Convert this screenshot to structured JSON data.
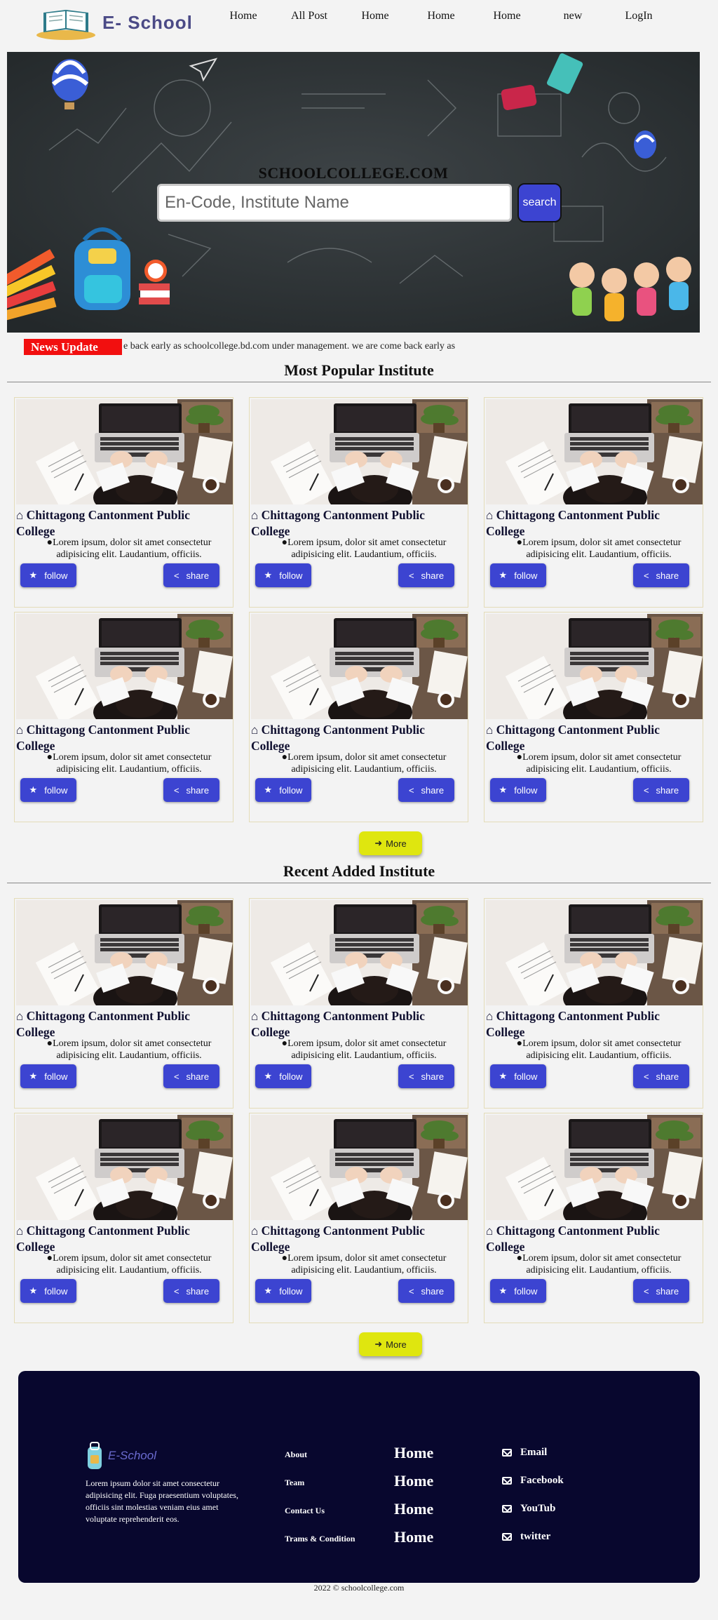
{
  "header": {
    "logo_text": "E- School",
    "nav": [
      "Home",
      "All Post",
      "Home",
      "Home",
      "Home",
      "new",
      "LogIn"
    ]
  },
  "hero": {
    "title": "SCHOOLCOLLEGE.COM",
    "search_placeholder": "En-Code, Institute Name",
    "search_button": "search"
  },
  "ticker": {
    "label": "News Update",
    "text": "e back early as schoolcollege.bd.com under management. we are come back early as"
  },
  "popular": {
    "title": "Most Popular Institute",
    "cards": [
      {
        "title": "Chittagong Cantonment Public College",
        "desc": "Lorem ipsum, dolor sit amet consectetur adipisicing elit. Laudantium, officiis.",
        "follow": "follow",
        "share": "share"
      },
      {
        "title": "Chittagong Cantonment Public College",
        "desc": "Lorem ipsum, dolor sit amet consectetur adipisicing elit. Laudantium, officiis.",
        "follow": "follow",
        "share": "share"
      },
      {
        "title": "Chittagong Cantonment Public College",
        "desc": "Lorem ipsum, dolor sit amet consectetur adipisicing elit. Laudantium, officiis.",
        "follow": "follow",
        "share": "share"
      },
      {
        "title": "Chittagong Cantonment Public College",
        "desc": "Lorem ipsum, dolor sit amet consectetur adipisicing elit. Laudantium, officiis.",
        "follow": "follow",
        "share": "share"
      },
      {
        "title": "Chittagong Cantonment Public College",
        "desc": "Lorem ipsum, dolor sit amet consectetur adipisicing elit. Laudantium, officiis.",
        "follow": "follow",
        "share": "share"
      },
      {
        "title": "Chittagong Cantonment Public College",
        "desc": "Lorem ipsum, dolor sit amet consectetur adipisicing elit. Laudantium, officiis.",
        "follow": "follow",
        "share": "share"
      }
    ],
    "more": "More"
  },
  "recent": {
    "title": "Recent Added Institute",
    "cards": [
      {
        "title": "Chittagong Cantonment Public College",
        "desc": "Lorem ipsum, dolor sit amet consectetur adipisicing elit. Laudantium, officiis.",
        "follow": "follow",
        "share": "share"
      },
      {
        "title": "Chittagong Cantonment Public College",
        "desc": "Lorem ipsum, dolor sit amet consectetur adipisicing elit. Laudantium, officiis.",
        "follow": "follow",
        "share": "share"
      },
      {
        "title": "Chittagong Cantonment Public College",
        "desc": "Lorem ipsum, dolor sit amet consectetur adipisicing elit. Laudantium, officiis.",
        "follow": "follow",
        "share": "share"
      },
      {
        "title": "Chittagong Cantonment Public College",
        "desc": "Lorem ipsum, dolor sit amet consectetur adipisicing elit. Laudantium, officiis.",
        "follow": "follow",
        "share": "share"
      },
      {
        "title": "Chittagong Cantonment Public College",
        "desc": "Lorem ipsum, dolor sit amet consectetur adipisicing elit. Laudantium, officiis.",
        "follow": "follow",
        "share": "share"
      },
      {
        "title": "Chittagong Cantonment Public College",
        "desc": "Lorem ipsum, dolor sit amet consectetur adipisicing elit. Laudantium, officiis.",
        "follow": "follow",
        "share": "share"
      }
    ],
    "more": "More"
  },
  "footer": {
    "logo_text": "E-School",
    "about": "Lorem ipsum dolor sit amet consectetur adipisicing elit. Fuga praesentium voluptates, officiis sint molestias veniam eius amet voluptate reprehenderit eos.",
    "links": [
      "About",
      "Team",
      "Contact Us",
      "Trams & Condition"
    ],
    "home_links": [
      "Home",
      "Home",
      "Home",
      "Home"
    ],
    "contacts": [
      "Email",
      "Facebook",
      "YouTub",
      "twitter"
    ]
  },
  "copyright": "2022 © schoolcollege.com",
  "colors": {
    "primary": "#3c44d1",
    "more": "#dfe60f",
    "footer_bg": "#08072e",
    "news": "#f20f0f"
  }
}
